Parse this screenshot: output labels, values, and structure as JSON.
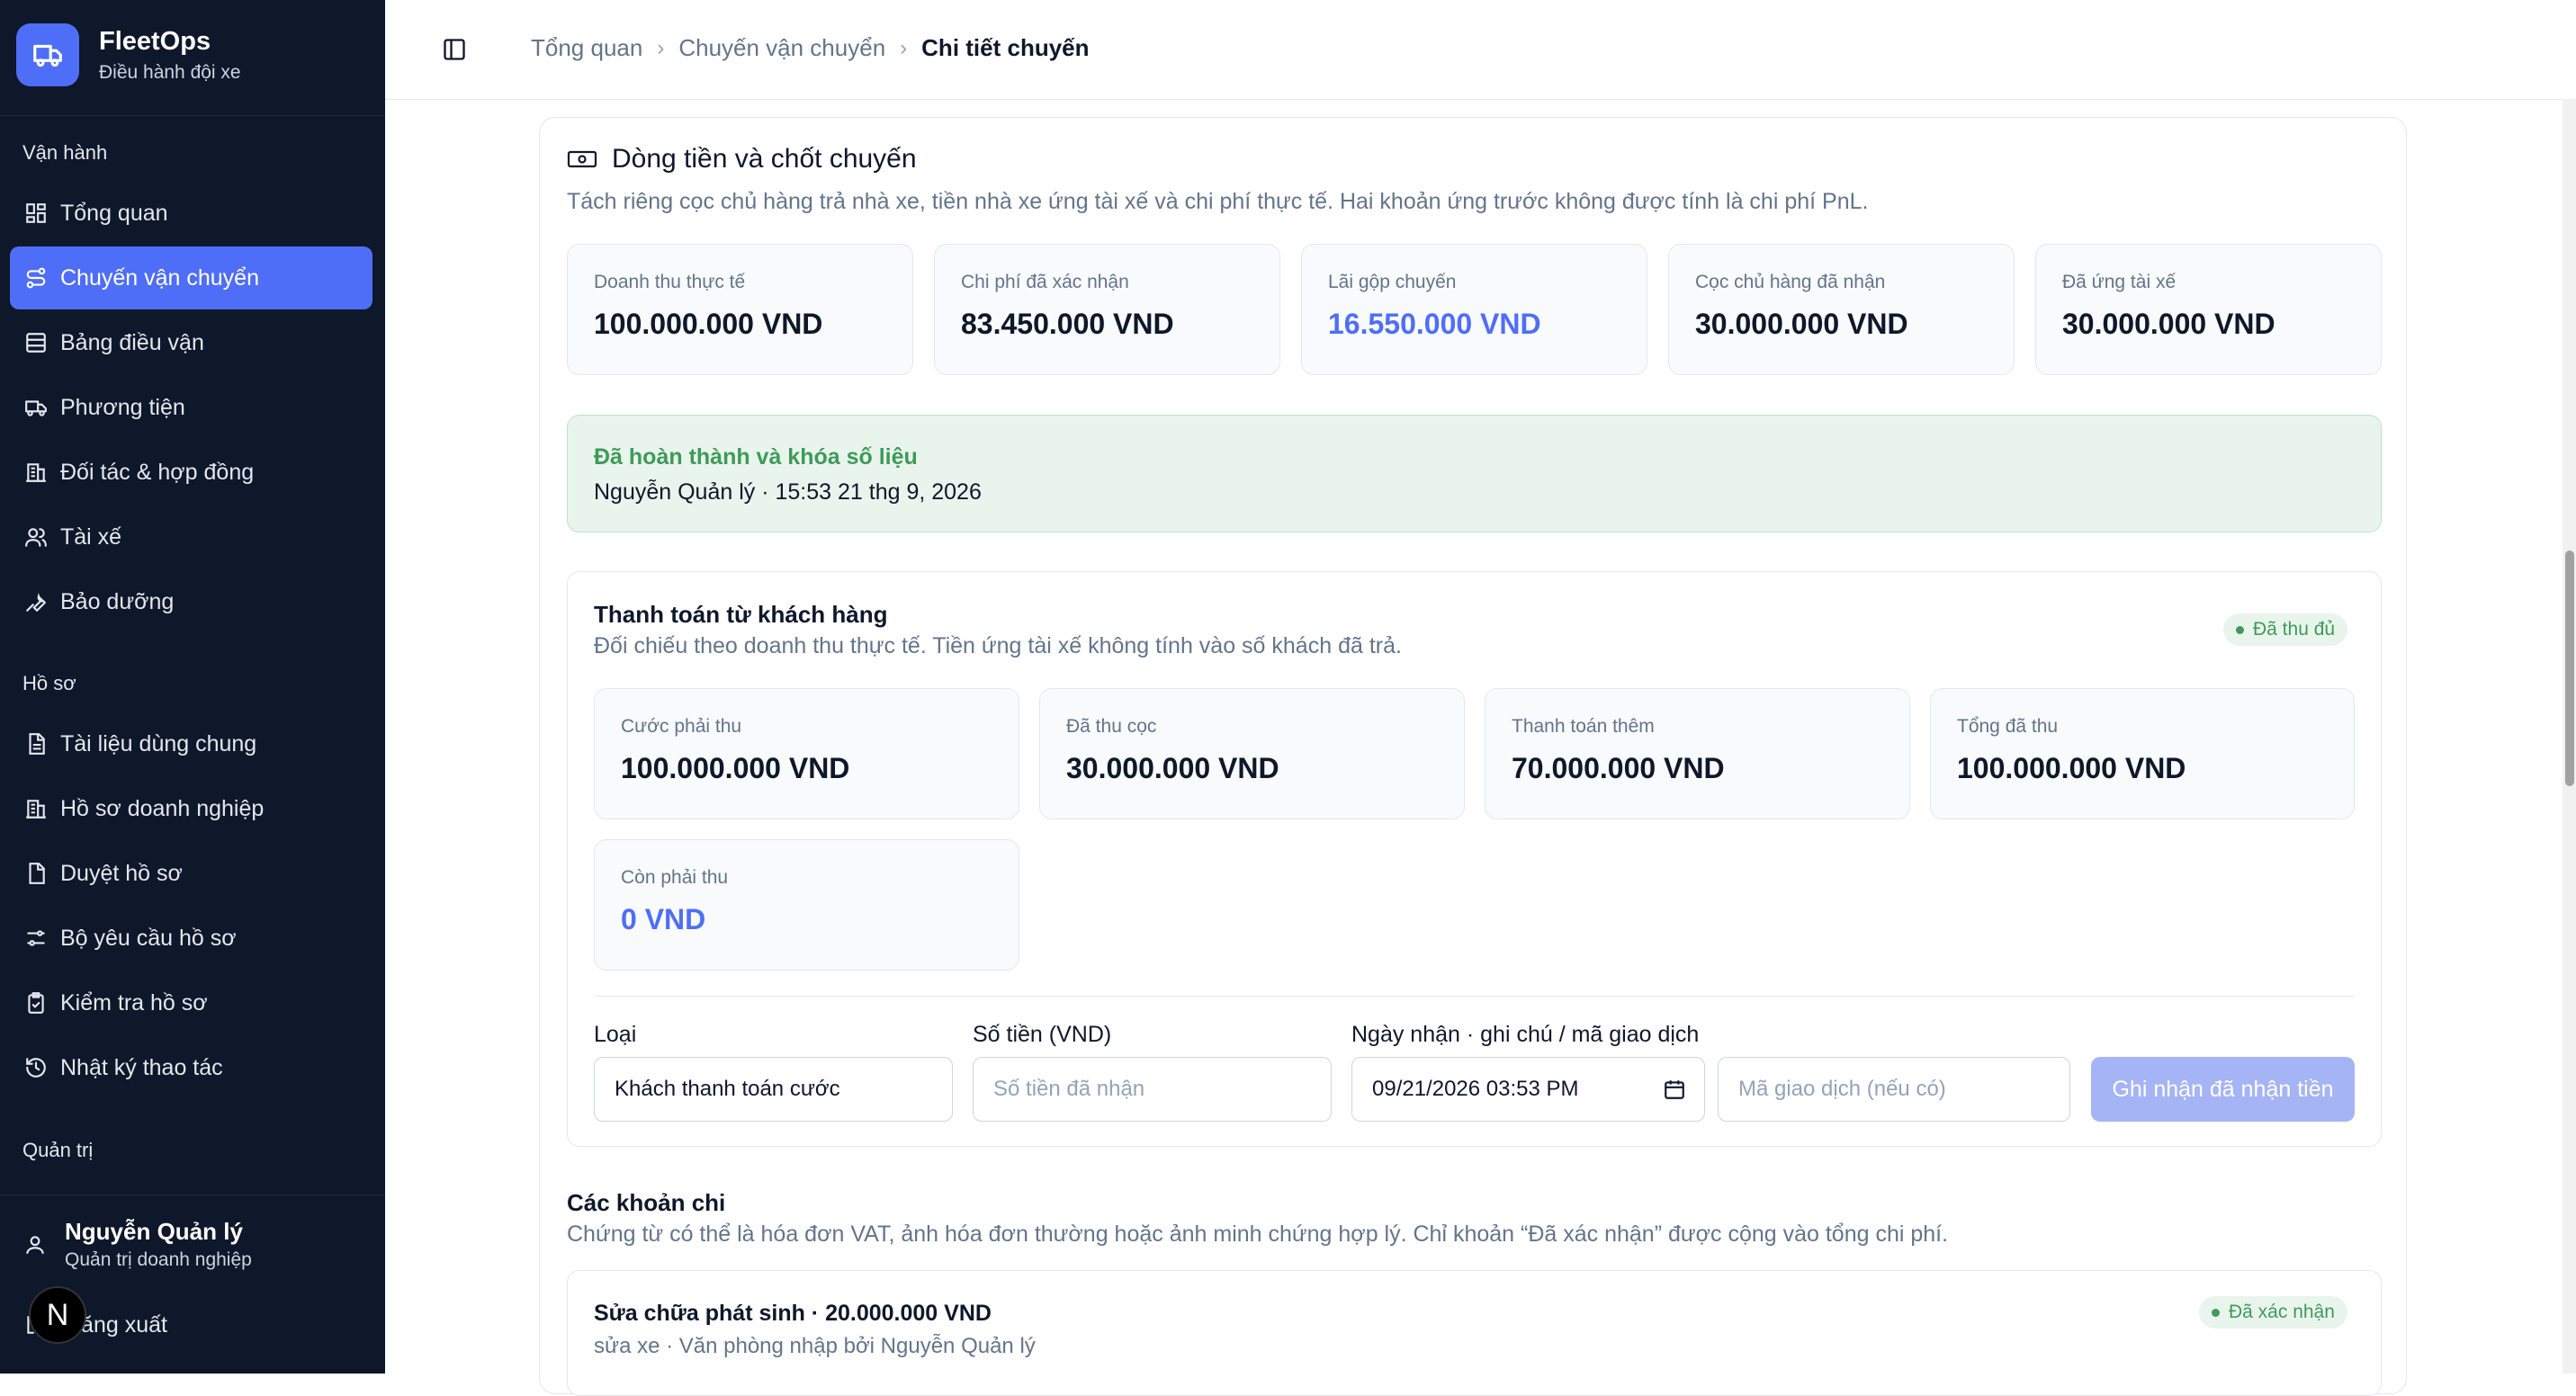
{
  "sidebar": {
    "brand": {
      "name": "FleetOps",
      "subtitle": "Điều hành đội xe"
    },
    "sections": {
      "operations": "Vận hành",
      "records": "Hồ sơ",
      "admin": "Quản trị"
    },
    "items": {
      "overview": "Tổng quan",
      "trips": "Chuyến vận chuyển",
      "dispatch": "Bảng điều vận",
      "vehicles": "Phương tiện",
      "partners": "Đối tác & hợp đồng",
      "drivers": "Tài xế",
      "maintenance": "Bảo dưỡng",
      "shared_docs": "Tài liệu dùng chung",
      "company_profile": "Hồ sơ doanh nghiệp",
      "review_profiles": "Duyệt hồ sơ",
      "profile_requirements": "Bộ yêu cầu hồ sơ",
      "check_profiles": "Kiểm tra hồ sơ",
      "activity_log": "Nhật ký thao tác"
    },
    "user": {
      "name": "Nguyễn Quản lý",
      "role": "Quản trị doanh nghiệp",
      "logout": "Đăng xuất"
    },
    "dev_badge": "N"
  },
  "breadcrumb": {
    "home": "Tổng quan",
    "list": "Chuyến vận chuyển",
    "current": "Chi tiết chuyến"
  },
  "cashflow": {
    "title": "Dòng tiền và chốt chuyến",
    "description": "Tách riêng cọc chủ hàng trả nhà xe, tiền nhà xe ứng tài xế và chi phí thực tế. Hai khoản ứng trước không được tính là chi phí PnL.",
    "stats": [
      {
        "label": "Doanh thu thực tế",
        "value": "100.000.000 VND"
      },
      {
        "label": "Chi phí đã xác nhận",
        "value": "83.450.000 VND"
      },
      {
        "label": "Lãi gộp chuyến",
        "value": "16.550.000 VND"
      },
      {
        "label": "Cọc chủ hàng đã nhận",
        "value": "30.000.000 VND"
      },
      {
        "label": "Đã ứng tài xế",
        "value": "30.000.000 VND"
      }
    ],
    "accent_color": "#4f6ef7"
  },
  "locked": {
    "title": "Đã hoàn thành và khóa số liệu",
    "detail": "Nguyễn Quản lý · 15:53 21 thg 9, 2026",
    "color": "#3f9a5a"
  },
  "payment": {
    "title": "Thanh toán từ khách hàng",
    "description": "Đối chiếu theo doanh thu thực tế. Tiền ứng tài xế không tính vào số khách đã trả.",
    "status": "Đã thu đủ",
    "stats": [
      {
        "label": "Cước phải thu",
        "value": "100.000.000 VND"
      },
      {
        "label": "Đã thu cọc",
        "value": "30.000.000 VND"
      },
      {
        "label": "Thanh toán thêm",
        "value": "70.000.000 VND"
      },
      {
        "label": "Tổng đã thu",
        "value": "100.000.000 VND"
      },
      {
        "label": "Còn phải thu",
        "value": "0 VND"
      }
    ],
    "form": {
      "type_label": "Loại",
      "type_value": "Khách thanh toán cước",
      "amount_label": "Số tiền (VND)",
      "amount_placeholder": "Số tiền đã nhận",
      "date_label": "Ngày nhận · ghi chú / mã giao dịch",
      "date_value": "09/21/2026 03:53 PM",
      "txn_placeholder": "Mã giao dịch (nếu có)",
      "submit": "Ghi nhận đã nhận tiền"
    }
  },
  "expenses": {
    "title": "Các khoản chi",
    "description": "Chứng từ có thể là hóa đơn VAT, ảnh hóa đơn thường hoặc ảnh minh chứng hợp lý. Chỉ khoản “Đã xác nhận” được cộng vào tổng chi phí.",
    "items": [
      {
        "title": "Sửa chữa phát sinh · 20.000.000 VND",
        "subtitle": "sửa xe · Văn phòng nhập bởi Nguyễn Quản lý",
        "status": "Đã xác nhận"
      }
    ]
  }
}
